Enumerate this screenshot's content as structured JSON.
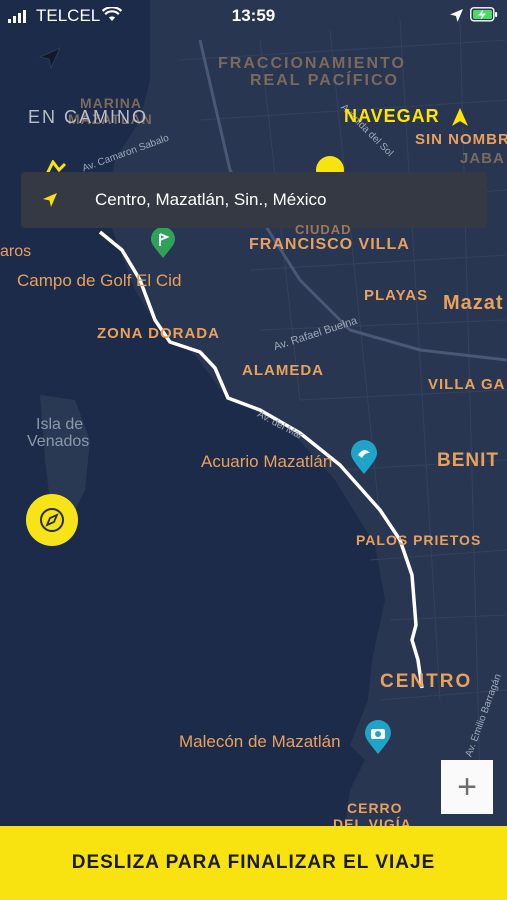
{
  "status_bar": {
    "carrier": "TELCEL",
    "time": "13:59"
  },
  "top_bar": {
    "mode_label": "EN CAMINO",
    "navigate_label": "NAVEGAR"
  },
  "search": {
    "address": "Centro, Mazatlán, Sin., México"
  },
  "map_labels": {
    "fraccionamiento": "FRACCIONAMIENTO",
    "real_pacifico": "REAL PACÍFICO",
    "marina": "MARINA",
    "mazatlan_marina": "MAZATLÁN",
    "av_camaron_sabalo": "Av. Camaron Sabalo",
    "av_del_sol": "Avenida del Sol",
    "sin_nombre": "SIN NOMBR",
    "jaba": "JABA",
    "ciudad": "CIUDAD",
    "francisco_villa": "FRANCISCO VILLA",
    "aros": "aros",
    "campo_golf": "Campo de Golf El Cid",
    "playas": "PLAYAS",
    "mazatlan_city": "Mazat",
    "zona_dorada": "ZONA DORADA",
    "av_rafael_buelna": "Av. Rafael Buelna",
    "alameda": "ALAMEDA",
    "villa_gal": "VILLA GA",
    "isla_venados_1": "Isla de",
    "isla_venados_2": "Venados",
    "av_del_mar": "Av. del Mar",
    "acuario": "Acuario Mazatlán",
    "benito": "BENIT",
    "palos_prietos": "PALOS PRIETOS",
    "centro": "CENTRO",
    "av_emilio_barragan": "Av. Emilio Barragán",
    "malecon": "Malecón de Mazatlán",
    "cerro": "CERRO",
    "del_vigia": "DEL VIGÍA"
  },
  "controls": {
    "zoom_in_label": "+",
    "compass_icon": "compass-icon",
    "navigate_icon": "navigation-arrow-icon"
  },
  "bottom": {
    "slide_label": "DESLIZA PARA FINALIZAR EL VIAJE"
  },
  "colors": {
    "accent": "#f8e310",
    "map_bg": "#1c2b49",
    "land": "#27344e",
    "label_orange": "#e8a15d",
    "route": "#ffffff"
  }
}
